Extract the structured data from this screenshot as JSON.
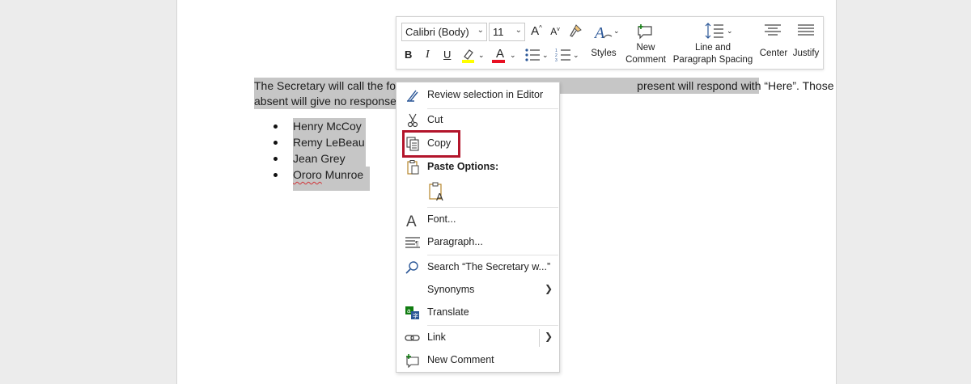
{
  "document": {
    "para_line1": "The Secretary will call the foll",
    "para_line1_tail": " present will respond with “Here”. Those",
    "para_line2": "absent will give no response.",
    "bullets": [
      "Henry McCoy",
      "Remy LeBeau",
      "Jean Grey",
      "Ororo Munroe"
    ]
  },
  "minibar": {
    "font_name": "Calibri (Body)",
    "font_size": "11",
    "styles_label": "Styles",
    "new_comment_label_1": "New",
    "new_comment_label_2": "Comment",
    "line_spacing_label_1": "Line and",
    "line_spacing_label_2": "Paragraph Spacing",
    "center_label": "Center",
    "justify_label": "Justify",
    "bold": "B",
    "italic": "I",
    "underline": "U",
    "grow_font": "A",
    "shrink_font": "A",
    "font_color_letter": "A"
  },
  "context_menu": {
    "review": "Review selection in Editor",
    "cut": "Cut",
    "copy": "Copy",
    "paste_options": "Paste Options:",
    "font": "Font...",
    "paragraph": "Paragraph...",
    "search": "Search “The Secretary w...”",
    "synonyms": "Synonyms",
    "translate": "Translate",
    "link": "Link",
    "new_comment": "New Comment"
  },
  "colors": {
    "selection": "#c6c6c6",
    "highlight_box": "#b3152b",
    "font_color_bar": "#e81123",
    "highlight_bar": "#ffff00",
    "editor_blue": "#2b5797"
  }
}
